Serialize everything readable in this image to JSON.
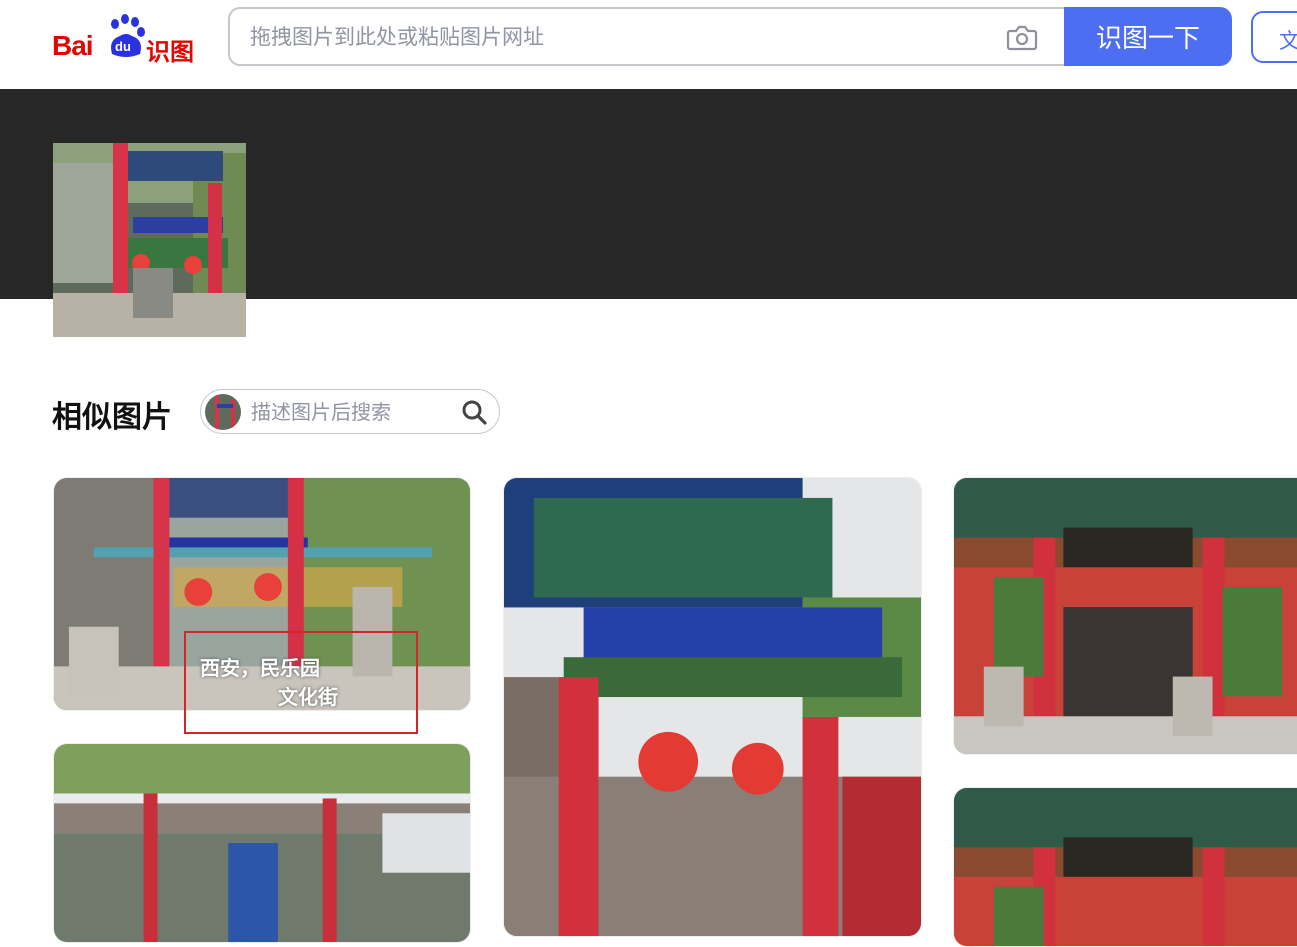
{
  "header": {
    "logo_prefix": "Bai",
    "logo_du": "du",
    "logo_product": "识图",
    "search_placeholder": "拖拽图片到此处或粘贴图片网址",
    "search_button": "识图一下",
    "text_button": "文"
  },
  "similar": {
    "title": "相似图片",
    "desc_placeholder": "描述图片后搜索"
  },
  "results": [
    {
      "caption_line1": "西安，民乐园",
      "caption_line2": "文化街"
    }
  ],
  "colors": {
    "brand_red": "#e10602",
    "brand_blue": "#4e6ef2",
    "banner": "#272727"
  },
  "icons": [
    "baidu-paw-icon",
    "camera-icon",
    "search-icon"
  ]
}
